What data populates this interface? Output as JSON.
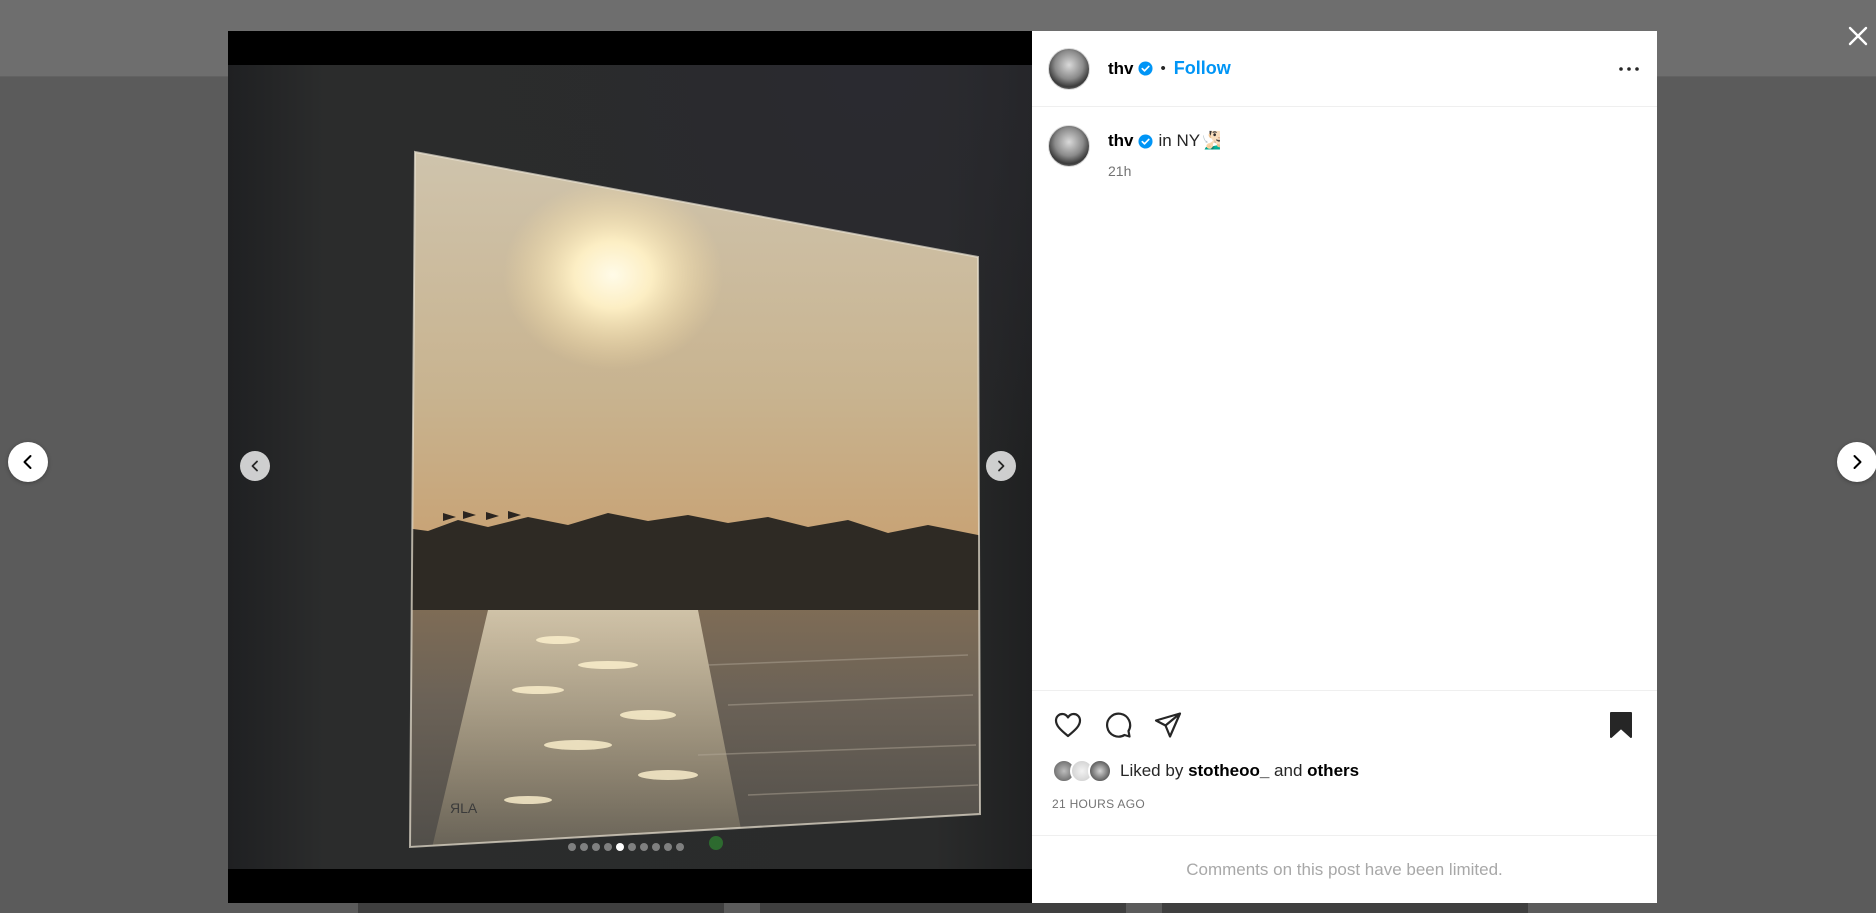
{
  "post": {
    "username": "thv",
    "follow_label": "Follow",
    "separator": "•",
    "caption_text": "in NY🧏🏻‍♂️",
    "caption_time": "21h",
    "liked_by_prefix": "Liked by",
    "liked_by_user": "stotheoo_",
    "liked_by_and": "and",
    "liked_by_others": "others",
    "post_time": "21 HOURS AGO",
    "comments_notice": "Comments on this post have been limited."
  },
  "media": {
    "watermark": "ЯLA",
    "slide_count": 10,
    "active_slide": 5
  },
  "icons": {
    "close": "close-icon",
    "prev": "chevron-left-icon",
    "next": "chevron-right-icon",
    "more": "more-options-icon",
    "like": "heart-icon",
    "comment": "comment-icon",
    "share": "share-icon",
    "save": "bookmark-icon",
    "verified": "verified-badge-icon"
  },
  "colors": {
    "accent": "#0095f6",
    "verified": "#0095f6",
    "secondary_text": "#737373",
    "notice_text": "#a8a8a8"
  }
}
